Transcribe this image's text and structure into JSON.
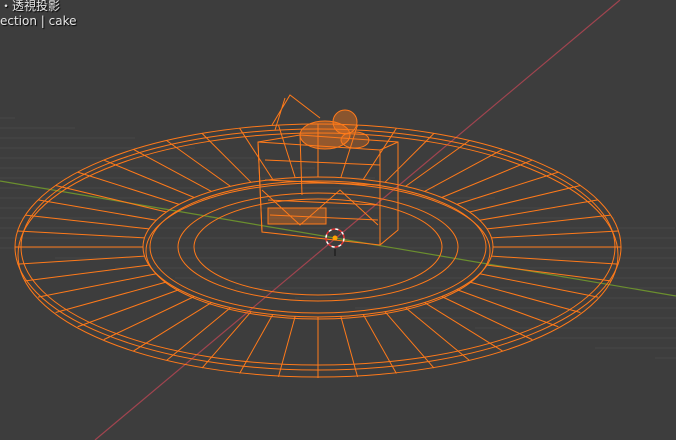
{
  "viewport": {
    "view_label": "・透視投影",
    "collection_label": "ection | cake"
  },
  "colors": {
    "background": "#3d3d3d",
    "wire": "#ff7a1a",
    "x_axis": "#a0444f",
    "y_axis": "#6b8f2e"
  }
}
